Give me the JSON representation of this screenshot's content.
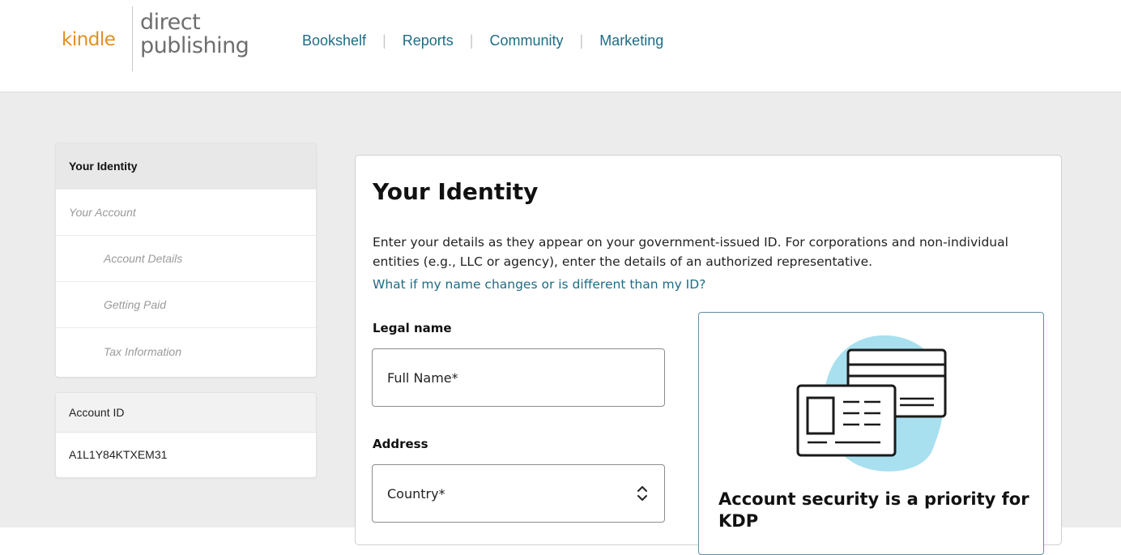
{
  "header": {
    "logo": {
      "word1": "kindle",
      "word2": "direct",
      "word3": "publishing"
    },
    "nav": [
      "Bookshelf",
      "Reports",
      "Community",
      "Marketing"
    ]
  },
  "sidebar": {
    "items": [
      {
        "label": "Your Identity"
      },
      {
        "label": "Your Account"
      },
      {
        "label": "Account Details"
      },
      {
        "label": "Getting Paid"
      },
      {
        "label": "Tax Information"
      }
    ],
    "account": {
      "label": "Account ID",
      "value": "A1L1Y84KTXEM31"
    }
  },
  "main": {
    "title": "Your Identity",
    "description": "Enter your details as they appear on your government-issued ID. For corporations and non-individual entities (e.g., LLC or agency), enter the details of an authorized representative.",
    "help_link": "What if my name changes or is different than my ID?",
    "legal_name_label": "Legal name",
    "full_name_placeholder": "Full Name*",
    "address_label": "Address",
    "country_placeholder": "Country*",
    "security_title": "Account security is a priority for KDP"
  },
  "colors": {
    "brand_orange": "#e38f1d",
    "link_teal": "#1f6c84",
    "illus_blue": "#a8e0ef"
  }
}
